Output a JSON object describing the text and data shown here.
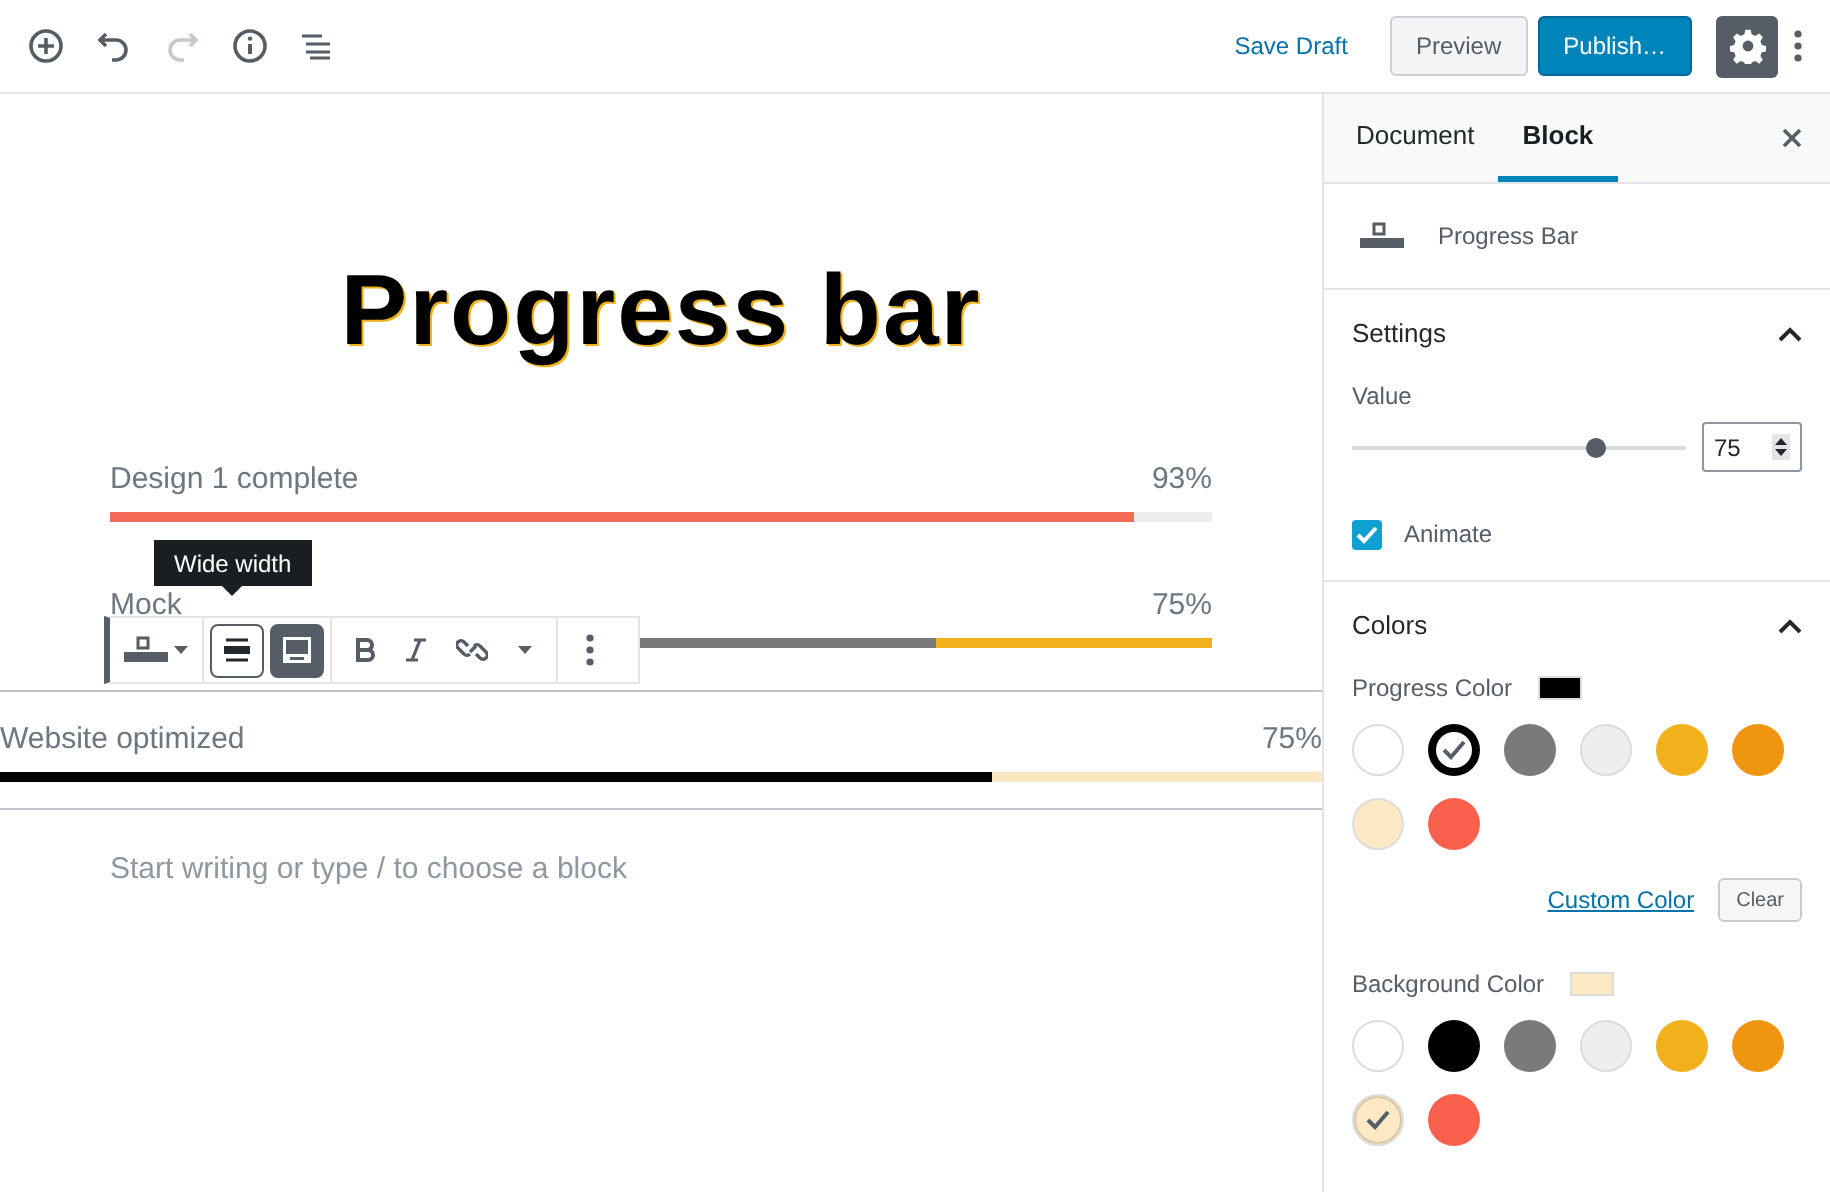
{
  "toolbar": {
    "save_draft": "Save Draft",
    "preview": "Preview",
    "publish": "Publish…",
    "settings_selected": true
  },
  "editor": {
    "title": "Progress bar",
    "bars": [
      {
        "label": "Design 1 complete",
        "reading": "93%",
        "level": 0.93,
        "fill": {
          "color": "#f26a55"
        },
        "track": {
          "color": "#eeeeee"
        },
        "wide": false
      },
      {
        "label": "Mock",
        "reading": "75%",
        "level": 0.75,
        "fill": {
          "color": "#7a7a7a"
        },
        "track": {
          "color": "#f0b11b"
        },
        "wide": false
      },
      {
        "label": "Website optimized",
        "reading": "75%",
        "level": 0.75,
        "fill": {
          "color": "#000000"
        },
        "track": {
          "color": "#fde8c4"
        },
        "wide": true
      }
    ],
    "tooltip": "Wide width",
    "placeholder": "Start writing or type / to choose a block"
  },
  "sidebar": {
    "tabs": [
      {
        "label": "Document",
        "selected": false
      },
      {
        "label": "Block",
        "selected": true
      }
    ],
    "block_name": "Progress Bar",
    "settings": {
      "title": "Settings",
      "expanded": true,
      "value_label": "Value",
      "level": 0.73,
      "value": "75",
      "animate_label": "Animate",
      "animate": true
    },
    "colors": {
      "title": "Colors",
      "expanded": true,
      "progress_label": "Progress Color",
      "progress_swatch": {
        "color": "#000000"
      },
      "progress_palette": [
        {
          "color": "#ffffff",
          "selected": false
        },
        {
          "color": "#000000",
          "selected": true
        },
        {
          "color": "#7a7a7a",
          "selected": false
        },
        {
          "color": "#eeeeee",
          "selected": false
        },
        {
          "color": "#f0b11b",
          "selected": false
        },
        {
          "color": "#ef950f",
          "selected": false
        },
        {
          "color": "#fde8c4",
          "selected": false
        },
        {
          "color": "#f9604e",
          "selected": false
        }
      ],
      "custom_color": "Custom Color",
      "clear": "Clear",
      "background_label": "Background Color",
      "background_swatch": {
        "color": "#fde8c4"
      },
      "background_palette": [
        {
          "color": "#ffffff",
          "selected": false
        },
        {
          "color": "#000000",
          "selected": false
        },
        {
          "color": "#7a7a7a",
          "selected": false
        },
        {
          "color": "#eeeeee",
          "selected": false
        },
        {
          "color": "#f0b11b",
          "selected": false
        },
        {
          "color": "#ef950f",
          "selected": false
        },
        {
          "color": "#fde8c4",
          "selected": true
        },
        {
          "color": "#f9604e",
          "selected": false
        }
      ]
    }
  }
}
